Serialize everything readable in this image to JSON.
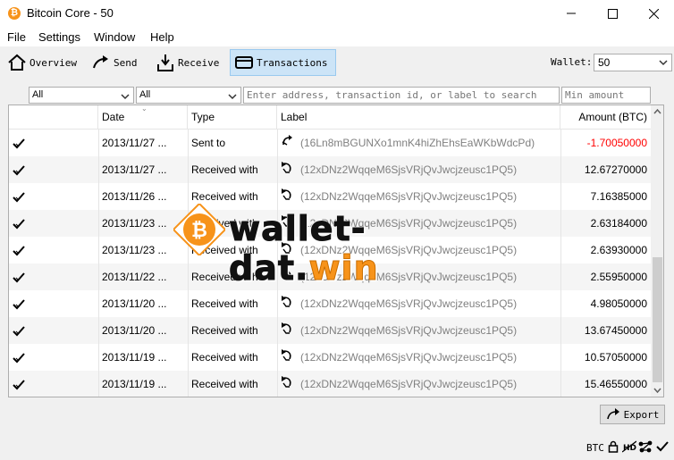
{
  "window": {
    "title": "Bitcoin Core - 50",
    "app_icon_glyph": "₿"
  },
  "menu": [
    "File",
    "Settings",
    "Window",
    "Help"
  ],
  "toolbar": {
    "overview": "Overview",
    "send": "Send",
    "receive": "Receive",
    "transactions": "Transactions",
    "wallet_label": "Wallet:",
    "wallet_value": "50"
  },
  "filters": {
    "date": "All",
    "type": "All",
    "search_placeholder": "Enter address, transaction id, or label to search",
    "amount_placeholder": "Min amount"
  },
  "table": {
    "headers": {
      "date": "Date",
      "type": "Type",
      "label": "Label",
      "amount": "Amount (BTC)"
    },
    "rows": [
      {
        "date": "2013/11/27 ...",
        "type": "Sent to",
        "label": "(16Ln8mBGUNXo1mnK4hiZhEhsEaWKbWdcPd)",
        "amount": "-1.70050000",
        "negative": true
      },
      {
        "date": "2013/11/27 ...",
        "type": "Received with",
        "label": "(12xDNz2WqqeM6SjsVRjQvJwcjzeusc1PQ5)",
        "amount": "12.67270000"
      },
      {
        "date": "2013/11/26 ...",
        "type": "Received with",
        "label": "(12xDNz2WqqeM6SjsVRjQvJwcjzeusc1PQ5)",
        "amount": "7.16385000"
      },
      {
        "date": "2013/11/23 ...",
        "type": "Received with",
        "label": "(12xDNz2WqqeM6SjsVRjQvJwcjzeusc1PQ5)",
        "amount": "2.63184000"
      },
      {
        "date": "2013/11/23 ...",
        "type": "Received with",
        "label": "(12xDNz2WqqeM6SjsVRjQvJwcjzeusc1PQ5)",
        "amount": "2.63930000"
      },
      {
        "date": "2013/11/22 ...",
        "type": "Received with",
        "label": "(12xDNz2WqqeM6SjsVRjQvJwcjzeusc1PQ5)",
        "amount": "2.55950000"
      },
      {
        "date": "2013/11/20 ...",
        "type": "Received with",
        "label": "(12xDNz2WqqeM6SjsVRjQvJwcjzeusc1PQ5)",
        "amount": "4.98050000"
      },
      {
        "date": "2013/11/20 ...",
        "type": "Received with",
        "label": "(12xDNz2WqqeM6SjsVRjQvJwcjzeusc1PQ5)",
        "amount": "13.67450000"
      },
      {
        "date": "2013/11/19 ...",
        "type": "Received with",
        "label": "(12xDNz2WqqeM6SjsVRjQvJwcjzeusc1PQ5)",
        "amount": "10.57050000"
      },
      {
        "date": "2013/11/19 ...",
        "type": "Received with",
        "label": "(12xDNz2WqqeM6SjsVRjQvJwcjzeusc1PQ5)",
        "amount": "15.46550000"
      }
    ]
  },
  "export_label": "Export",
  "status": {
    "unit": "BTC"
  },
  "watermark": {
    "coin_glyph": "₿",
    "text": "wallet-dat.",
    "accent": "win"
  },
  "colors": {
    "accent": "#f7931a",
    "negative": "#ff0000",
    "selected_tab": "#cce4f7"
  }
}
